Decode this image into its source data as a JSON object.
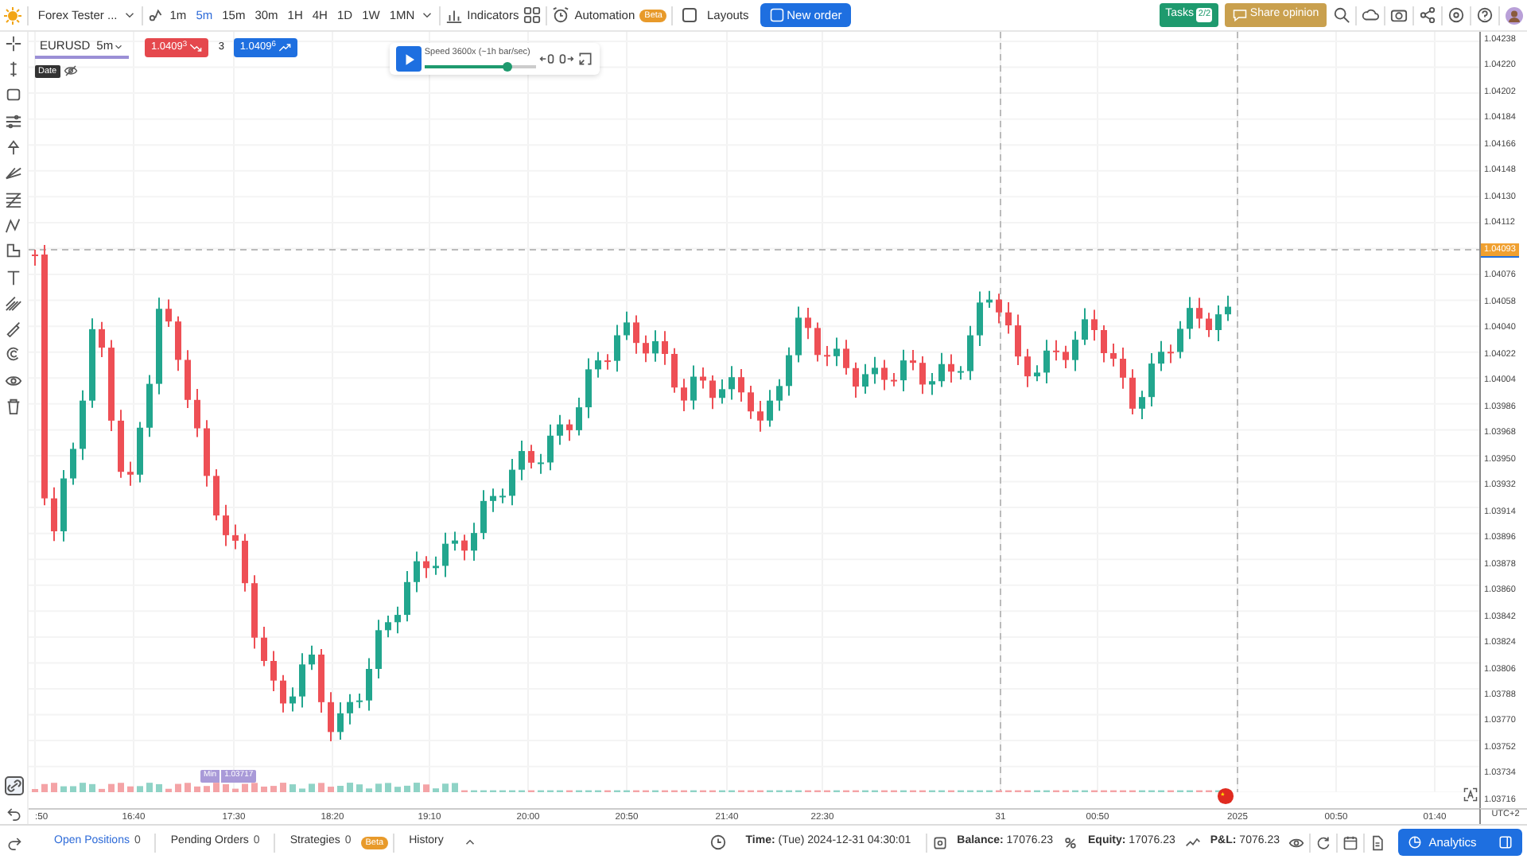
{
  "topbar": {
    "app_title": "Forex Tester ...",
    "timeframes": [
      {
        "label": "1m",
        "selected": false
      },
      {
        "label": "5m",
        "selected": true
      },
      {
        "label": "15m",
        "selected": false
      },
      {
        "label": "30m",
        "selected": false
      },
      {
        "label": "1H",
        "selected": false
      },
      {
        "label": "4H",
        "selected": false
      },
      {
        "label": "1D",
        "selected": false
      },
      {
        "label": "1W",
        "selected": false
      },
      {
        "label": "1MN",
        "selected": false
      }
    ],
    "indicators": "Indicators",
    "automation": {
      "label": "Automation",
      "badge": "Beta"
    },
    "layouts": {
      "label": "Layouts",
      "checked": false
    },
    "new_order": "New order",
    "tasks": {
      "label": "Tasks",
      "count": "2/2"
    },
    "share_opinion": "Share opinion"
  },
  "chart": {
    "symbol": "EURUSD",
    "timeframe": "5m",
    "sell_price": "1.0409$^{3}$",
    "spread": "3",
    "buy_price": "1.0409$^{6}$",
    "tooltip": "Date",
    "playback": {
      "speed_label": "Speed 3600x (~1h bar/sec)",
      "level": 0.75
    },
    "min_label": {
      "label": "Min",
      "value": "1.03717"
    },
    "current_price": "1.04093",
    "price_axis": [
      "1.04238",
      "1.04220",
      "1.04202",
      "1.04184",
      "1.04166",
      "1.04148",
      "1.04130",
      "1.04112",
      "1.04076",
      "1.04058",
      "1.04040",
      "1.04022",
      "1.04004",
      "1.03986",
      "1.03968",
      "1.03950",
      "1.03932",
      "1.03914",
      "1.03896",
      "1.03878",
      "1.03860",
      "1.03842",
      "1.03824",
      "1.03806",
      "1.03788",
      "1.03770",
      "1.03752",
      "1.03734",
      "1.03716"
    ],
    "time_axis": [
      ":50",
      "16:40",
      "17:30",
      "18:20",
      "19:10",
      "20:00",
      "20:50",
      "21:40",
      "22:30",
      "31",
      "00:50",
      "2025",
      "00:50",
      "01:40"
    ],
    "timezone": "UTC+2"
  },
  "bottom_tabs": [
    {
      "label": "Open Positions",
      "count": "0",
      "selected": true
    },
    {
      "label": "Pending Orders",
      "count": "0",
      "selected": false
    },
    {
      "label": "Strategies",
      "count": "0",
      "badge": "Beta",
      "selected": false
    },
    {
      "label": "History",
      "selected": false
    }
  ],
  "status": {
    "time": "**Time:** (Tue) 2024-12-31 04:30:01",
    "balance": "**Balance:** 17076.23",
    "equity": "**Equity:** 17076.23",
    "pnl": "**P&L:** 7076.23"
  },
  "analytics_button": "Analytics"
}
